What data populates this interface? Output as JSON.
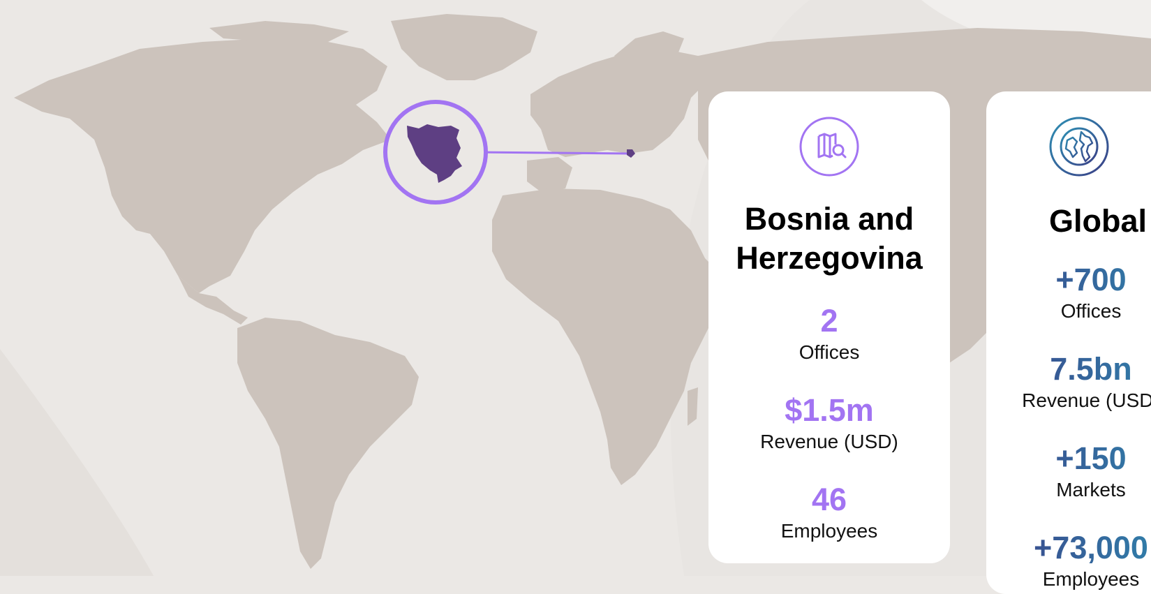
{
  "colors": {
    "background": "#ebe8e5",
    "land": "#ccc3bc",
    "accent_purple": "#a274f2",
    "country_fill": "#5e3f83",
    "global_gradient_start": "#3b3f86",
    "global_gradient_end": "#2e8fb3",
    "card_bg": "#ffffff"
  },
  "map": {
    "highlight_icon": "bosnia-and-herzegovina-silhouette"
  },
  "local_card": {
    "icon": "map-search-icon",
    "title_line1": "Bosnia and",
    "title_line2": "Herzegovina",
    "stats": [
      {
        "value": "2",
        "label": "Offices"
      },
      {
        "value": "$1.5m",
        "label": "Revenue (USD)"
      },
      {
        "value": "46",
        "label": "Employees"
      }
    ]
  },
  "global_card": {
    "icon": "globe-icon",
    "title": "Global",
    "stats": [
      {
        "value": "+700",
        "label": "Offices"
      },
      {
        "value": "7.5bn",
        "label": "Revenue (USD)"
      },
      {
        "value": "+150",
        "label": "Markets"
      },
      {
        "value": "+73,000",
        "label": "Employees"
      }
    ]
  }
}
